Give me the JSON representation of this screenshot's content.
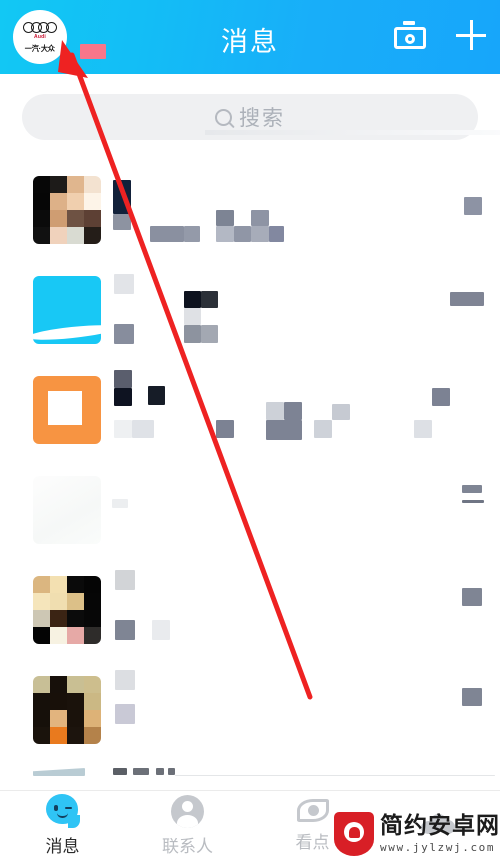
{
  "app": {
    "header": {
      "title": "消息",
      "avatar": {
        "name": "一汽·大众 Audi",
        "brand_word": "Audi",
        "brand_cn": "一汽·大众"
      },
      "actions": [
        {
          "name": "camera",
          "icon": "camera-icon",
          "label": "扫一扫"
        },
        {
          "name": "add",
          "icon": "plus-icon",
          "label": "添加"
        }
      ],
      "gradient_from": "#12c8f4",
      "gradient_to": "#17a6fa"
    },
    "search": {
      "placeholder": "搜索",
      "icon": "search-icon",
      "value": ""
    },
    "chat_list": [
      {
        "id": 1,
        "name": "",
        "preview": "",
        "time": "",
        "avatar_type": "photo-dark",
        "redacted": true
      },
      {
        "id": 2,
        "name": "",
        "preview": "",
        "time": "",
        "avatar_type": "cyan-wave",
        "redacted": true
      },
      {
        "id": 3,
        "name": "",
        "preview": "",
        "time": "",
        "avatar_type": "orange-frame",
        "redacted": true
      },
      {
        "id": 4,
        "name": "",
        "preview": "",
        "time": "",
        "avatar_type": "faint",
        "redacted": true
      },
      {
        "id": 5,
        "name": "",
        "preview": "",
        "time": "",
        "avatar_type": "photo-light",
        "redacted": true
      },
      {
        "id": 6,
        "name": "",
        "preview": "",
        "time": "",
        "avatar_type": "photo-warm",
        "redacted": true
      }
    ],
    "tabs": [
      {
        "id": "messages",
        "label": "消息",
        "icon": "qq-face-icon",
        "active": true
      },
      {
        "id": "contacts",
        "label": "联系人",
        "icon": "person-icon",
        "active": false
      },
      {
        "id": "kandian",
        "label": "看点",
        "icon": "eye-icon",
        "active": false
      },
      {
        "id": "profile",
        "label": "",
        "icon": "cloud-icon",
        "active": false
      }
    ],
    "annotation": {
      "type": "arrow",
      "color": "#ee2222",
      "points_to": "header-avatar"
    },
    "watermark": {
      "title": "简约安卓网",
      "url": "www.jylzwj.com",
      "badge_color": "#d81f26"
    }
  }
}
